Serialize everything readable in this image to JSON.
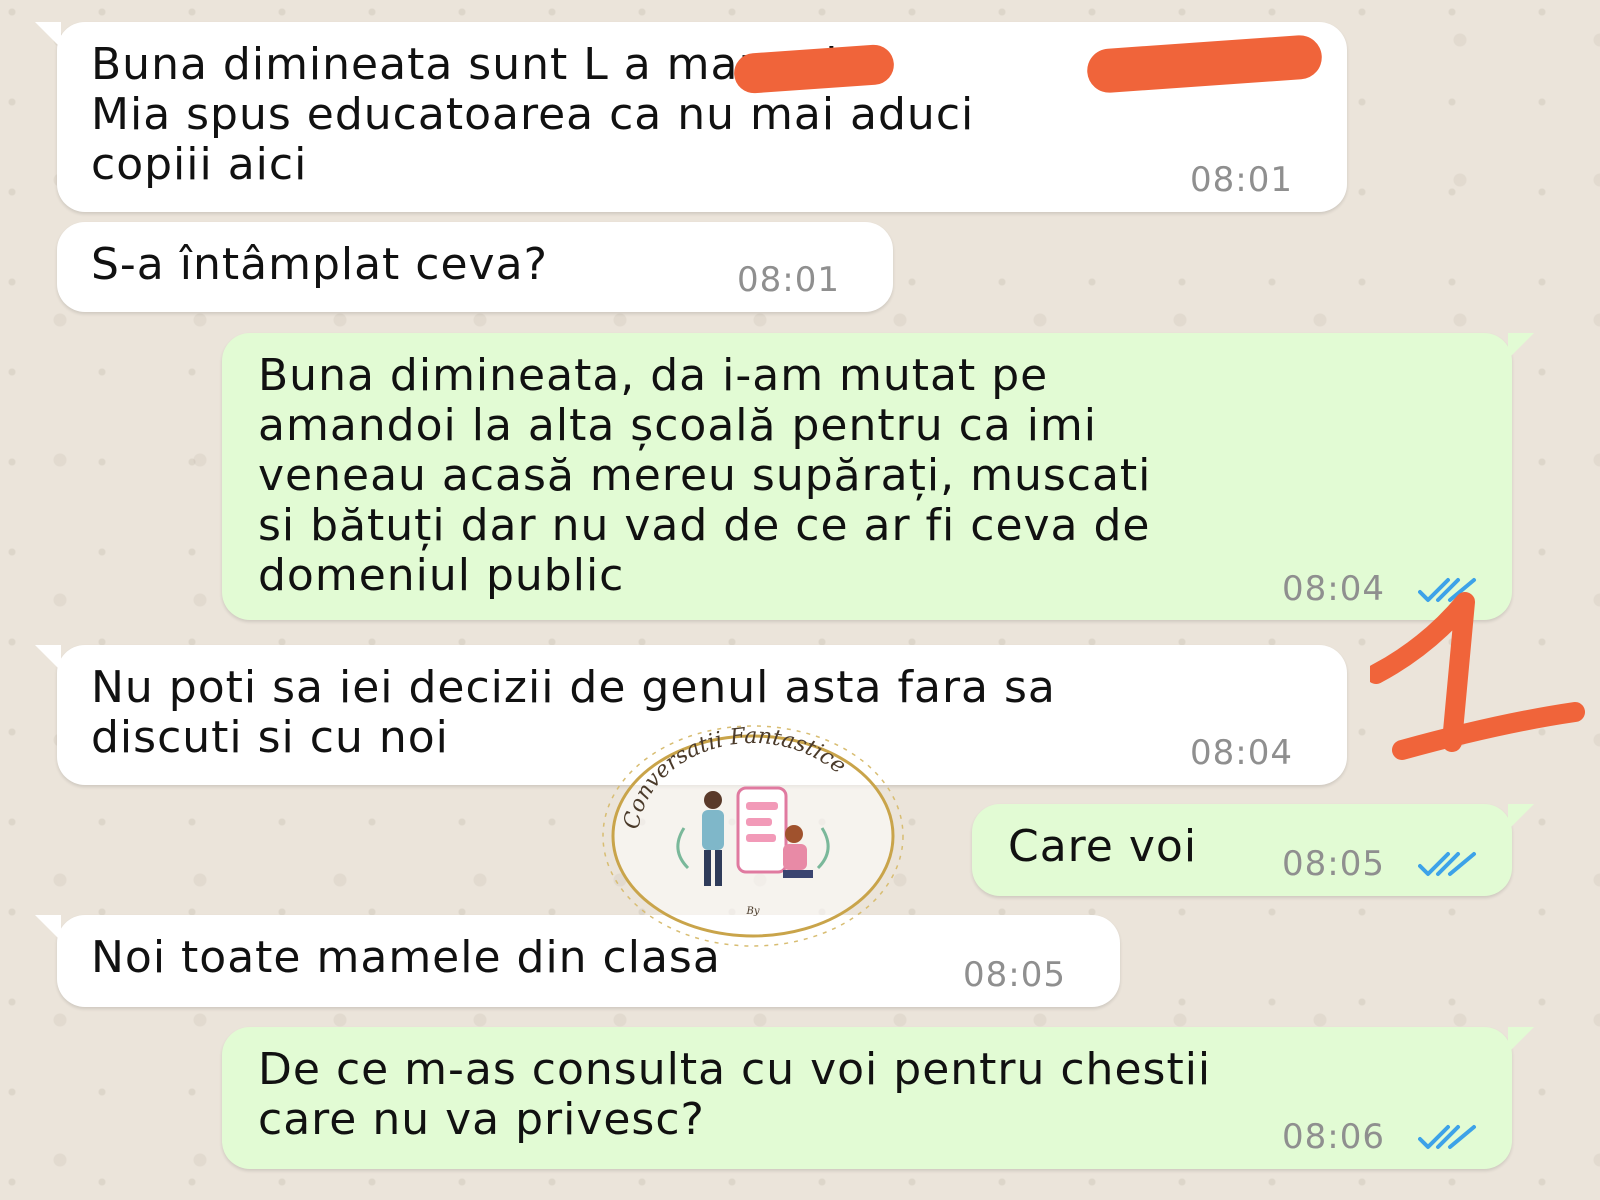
{
  "colors": {
    "incoming_bubble": "#ffffff",
    "outgoing_bubble": "#e2fbd4",
    "timestamp": "#8f8f8f",
    "read_ticks": "#3da2e8",
    "redaction": "#f0643a"
  },
  "messages": [
    {
      "direction": "in",
      "text": "Buna dimineata sunt L        a mama i\nMia spus educatoarea ca nu mai aduci\ncopiii aici",
      "time": "08:01"
    },
    {
      "direction": "in",
      "text": "S-a întâmplat ceva?",
      "time": "08:01"
    },
    {
      "direction": "out",
      "text": "Buna dimineata, da i-am mutat pe\namandoi la alta școală pentru ca imi\nveneau acasă mereu supărați, muscati\nsi bătuți dar nu vad de ce ar fi ceva de\ndomeniul public",
      "time": "08:04",
      "status_icon": "double-check-icon"
    },
    {
      "direction": "in",
      "text": "Nu poti sa iei decizii de genul asta fara sa\ndiscuti si cu noi",
      "time": "08:04"
    },
    {
      "direction": "out",
      "text": "Care voi",
      "time": "08:05",
      "status_icon": "double-check-icon"
    },
    {
      "direction": "in",
      "text": "Noi toate mamele din clasa",
      "time": "08:05"
    },
    {
      "direction": "out",
      "text": "De ce m-as consulta cu voi pentru chestii\ncare nu va privesc?",
      "time": "08:06",
      "status_icon": "double-check-icon"
    }
  ],
  "watermark": {
    "title": "Conversatii Fantastice",
    "byline": "By"
  },
  "annotation": {
    "number": "1"
  }
}
